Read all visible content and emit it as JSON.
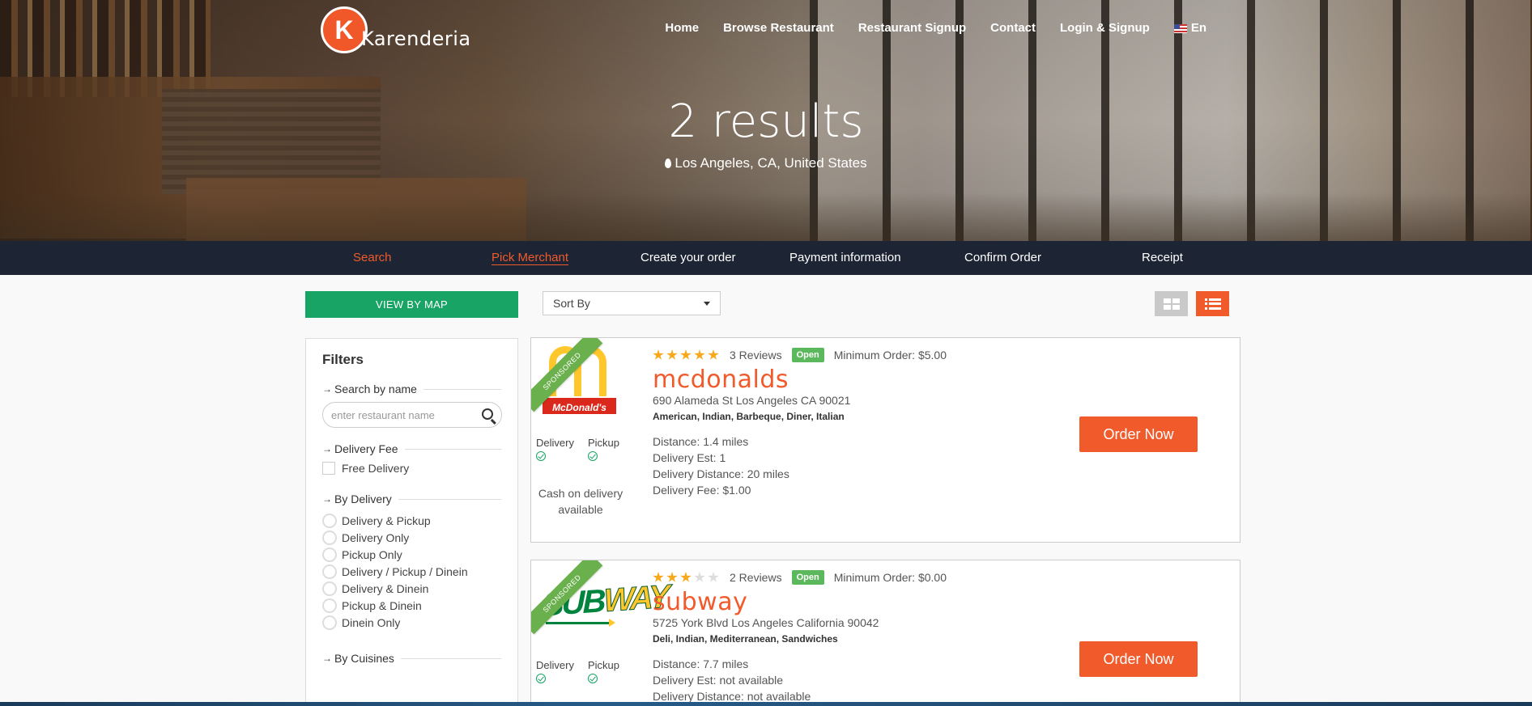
{
  "brand": {
    "logo_letter": "K",
    "name": "Karenderia",
    "accent": "#f15a2b"
  },
  "nav": {
    "items": [
      "Home",
      "Browse Restaurant",
      "Restaurant Signup",
      "Contact",
      "Login & Signup"
    ],
    "language": "En"
  },
  "hero": {
    "title": "2 results",
    "location": "Los Angeles, CA, United States"
  },
  "steps": [
    "Search",
    "Pick Merchant",
    "Create your order",
    "Payment information",
    "Confirm Order",
    "Receipt"
  ],
  "toolbar": {
    "view_map": "VIEW BY MAP",
    "sort_label": "Sort By"
  },
  "filters": {
    "title": "Filters",
    "search_heading": "Search by name",
    "search_placeholder": "enter restaurant name",
    "fee_heading": "Delivery Fee",
    "free_delivery": "Free Delivery",
    "delivery_heading": "By Delivery",
    "delivery_options": [
      "Delivery & Pickup",
      "Delivery Only",
      "Pickup Only",
      "Delivery / Pickup / Dinein",
      "Delivery & Dinein",
      "Pickup & Dinein",
      "Dinein Only"
    ],
    "cuisine_heading": "By Cuisines"
  },
  "merchants": [
    {
      "ribbon": "SPONSORED",
      "logo_text": "McDonald's",
      "rating": 5,
      "reviews": "3 Reviews",
      "status": "Open",
      "min_order": "Minimum Order: $5.00",
      "name": "mcdonalds",
      "address": "690 Alameda St Los Angeles CA 90021",
      "cuisines": "American, Indian, Barbeque, Diner, Italian",
      "delivery": "Delivery",
      "pickup": "Pickup",
      "cash": "Cash on delivery available",
      "distance": "Distance: 1.4 miles",
      "est": "Delivery Est: 1",
      "delivery_distance": "Delivery Distance: 20 miles",
      "fee": "Delivery Fee: $1.00",
      "order_button": "Order Now"
    },
    {
      "ribbon": "SPONSORED",
      "logo_text_a": "SUB",
      "logo_text_b": "WAY",
      "rating": 3,
      "reviews": "2 Reviews",
      "status": "Open",
      "min_order": "Minimum Order: $0.00",
      "name": "subway",
      "address": "5725 York Blvd Los Angeles California 90042",
      "cuisines": "Deli, Indian, Mediterranean, Sandwiches",
      "delivery": "Delivery",
      "pickup": "Pickup",
      "distance": "Distance: 7.7 miles",
      "est": "Delivery Est: not available",
      "delivery_distance": "Delivery Distance: not available",
      "order_button": "Order Now"
    }
  ]
}
